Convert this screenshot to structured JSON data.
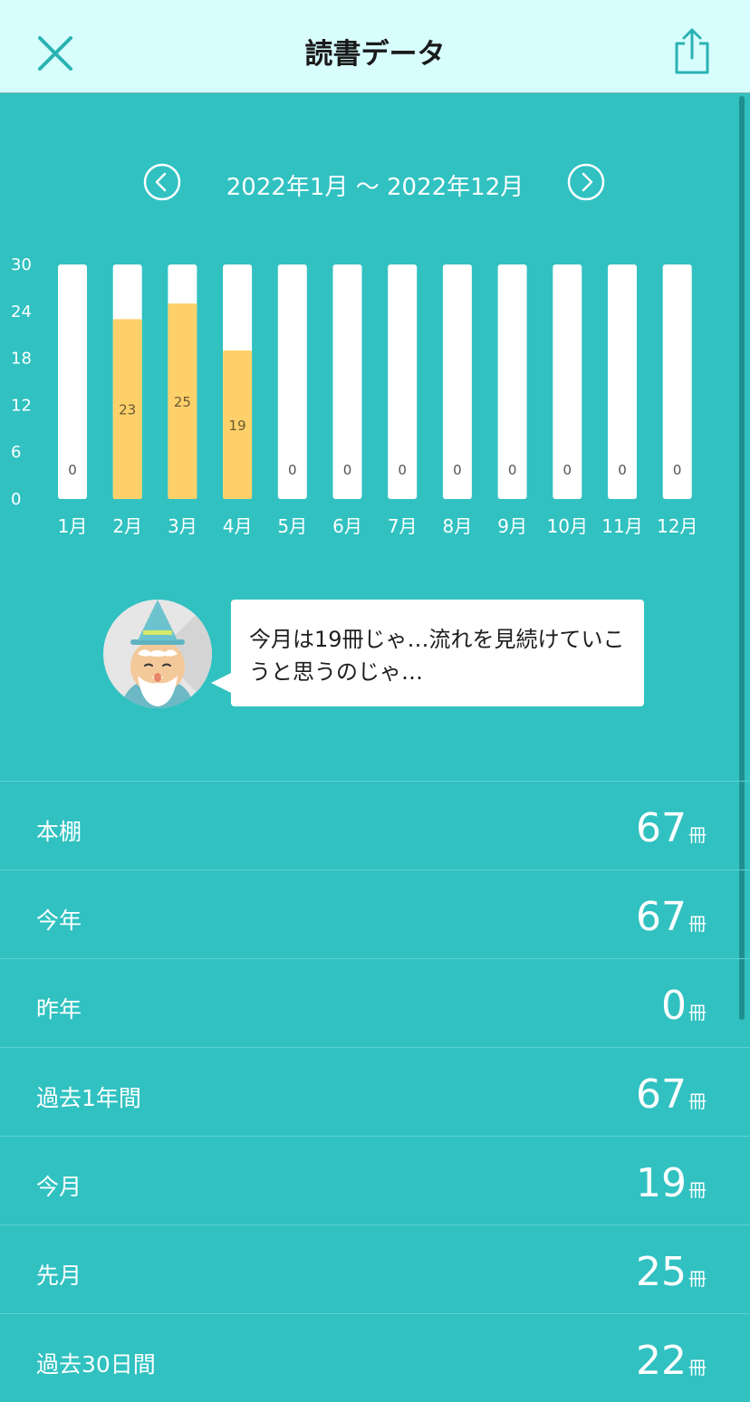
{
  "header": {
    "title": "読書データ",
    "close_icon": "close-icon",
    "share_icon": "share-icon"
  },
  "range": {
    "label": "2022年1月 〜 2022年12月",
    "prev_icon": "chevron-left-icon",
    "next_icon": "chevron-right-icon"
  },
  "colors": {
    "background": "#31c1c1",
    "header": "#d8fdfd",
    "bar_filled": "#fdd06a",
    "bar_empty": "#ffffff",
    "accent": "#2ab3b3"
  },
  "chart_data": {
    "type": "bar",
    "categories": [
      "1月",
      "2月",
      "3月",
      "4月",
      "5月",
      "6月",
      "7月",
      "8月",
      "9月",
      "10月",
      "11月",
      "12月"
    ],
    "values": [
      0,
      23,
      25,
      19,
      0,
      0,
      0,
      0,
      0,
      0,
      0,
      0
    ],
    "ylim": [
      0,
      30
    ],
    "yticks": [
      "0",
      "6",
      "12",
      "18",
      "24",
      "30"
    ],
    "title": "",
    "xlabel": "",
    "ylabel": "",
    "grid": false
  },
  "message": {
    "text": "今月は19冊じゃ…流れを見続けていこうと思うのじゃ…",
    "avatar_icon": "wizard-avatar-icon"
  },
  "stats": [
    {
      "label": "本棚",
      "value": "67",
      "unit": "冊"
    },
    {
      "label": "今年",
      "value": "67",
      "unit": "冊"
    },
    {
      "label": "昨年",
      "value": "0",
      "unit": "冊"
    },
    {
      "label": "過去1年間",
      "value": "67",
      "unit": "冊"
    },
    {
      "label": "今月",
      "value": "19",
      "unit": "冊"
    },
    {
      "label": "先月",
      "value": "25",
      "unit": "冊"
    },
    {
      "label": "過去30日間",
      "value": "22",
      "unit": "冊"
    }
  ]
}
